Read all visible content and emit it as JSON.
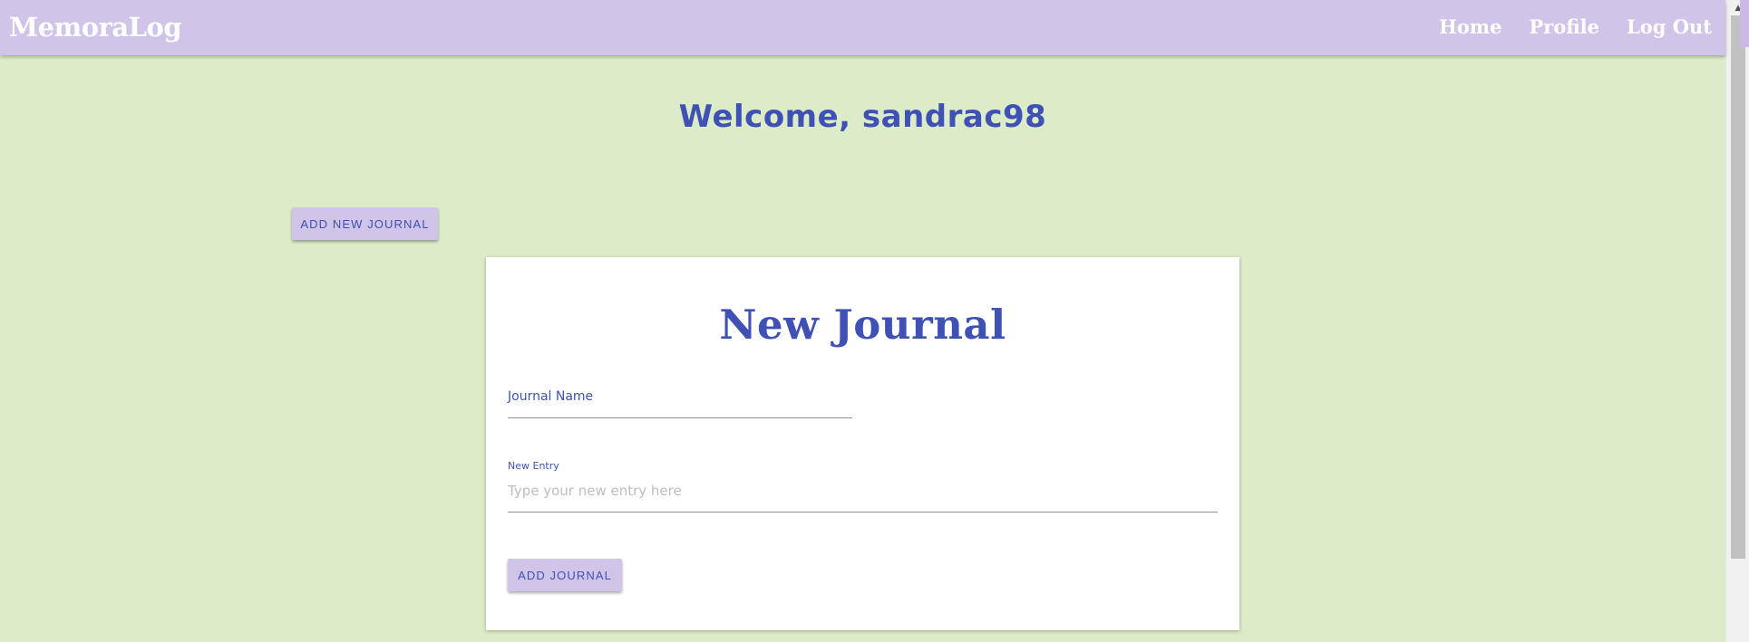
{
  "appbar": {
    "brand": "MemoraLog",
    "nav": [
      {
        "label": "Home"
      },
      {
        "label": "Profile"
      },
      {
        "label": "Log Out"
      }
    ]
  },
  "main": {
    "welcome": "Welcome, sandrac98",
    "add_new_journal_label": "ADD NEW JOURNAL"
  },
  "form": {
    "title": "New Journal",
    "journal_name_label": "Journal Name",
    "journal_name_value": "",
    "new_entry_label": "New Entry",
    "new_entry_placeholder": "Type your new entry here",
    "submit_label": "ADD JOURNAL"
  },
  "colors": {
    "background": "#ddecc8",
    "appbar": "#d1c4e9",
    "accent": "#3f51b5",
    "card": "#ffffff"
  },
  "icons": {
    "scroll_up": "chevron-up-icon"
  }
}
